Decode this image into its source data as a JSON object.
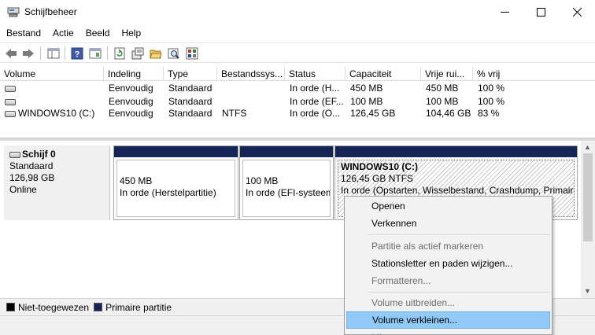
{
  "window": {
    "title": "Schijfbeheer"
  },
  "menu": [
    "Bestand",
    "Actie",
    "Beeld",
    "Help"
  ],
  "toolbar": {
    "buttons": [
      "back-icon",
      "forward-icon",
      "console-tree-icon",
      "help-icon",
      "properties-view-icon",
      "refresh-icon",
      "disk-properties-icon",
      "open-folder-icon",
      "search-icon",
      "settings-list-icon"
    ]
  },
  "volumes": {
    "headers": [
      "Volume",
      "Indeling",
      "Type",
      "Bestandssys...",
      "Status",
      "Capaciteit",
      "Vrije rui...",
      "% vrij"
    ],
    "rows": [
      [
        "",
        "Eenvoudig",
        "Standaard",
        "",
        "In orde (H...",
        "450 MB",
        "450 MB",
        "100 %"
      ],
      [
        "",
        "Eenvoudig",
        "Standaard",
        "",
        "In orde (EF...",
        "100 MB",
        "100 MB",
        "100 %"
      ],
      [
        "WINDOWS10 (C:)",
        "Eenvoudig",
        "Standaard",
        "NTFS",
        "In orde (O...",
        "126,45 GB",
        "104,46 GB",
        "83 %"
      ]
    ]
  },
  "disk": {
    "name": "Schijf 0",
    "type": "Standaard",
    "size": "126,98 GB",
    "state": "Online",
    "partitions": [
      {
        "line1": "",
        "line2": "450 MB",
        "line3": "In orde (Herstelpartitie)"
      },
      {
        "line1": "",
        "line2": "100 MB",
        "line3": "In orde (EFI-systeempartitie)"
      },
      {
        "line1": "WINDOWS10  (C:)",
        "line2": "126,45 GB NTFS",
        "line3": "In orde (Opstarten, Wisselbestand, Crashdump, Primaire partitie)"
      }
    ]
  },
  "legend": [
    {
      "label": "Niet-toegewezen",
      "color": "#000000"
    },
    {
      "label": "Primaire partitie",
      "color": "#152555"
    }
  ],
  "context_menu": {
    "items": [
      {
        "label": "Openen",
        "enabled": true
      },
      {
        "label": "Verkennen",
        "enabled": true
      },
      {
        "label": "Partitie als actief markeren",
        "enabled": false
      },
      {
        "label": "Stationsletter en paden wijzigen...",
        "enabled": true
      },
      {
        "label": "Formatteren...",
        "enabled": false
      },
      {
        "label": "Volume uitbreiden...",
        "enabled": false
      },
      {
        "label": "Volume verkleinen...",
        "enabled": true,
        "highlighted": true
      },
      {
        "label": "Mirror toevoegen...",
        "enabled": false
      }
    ]
  },
  "colors": {
    "partition_bar": "#152555",
    "highlight": "#91c9f7"
  }
}
